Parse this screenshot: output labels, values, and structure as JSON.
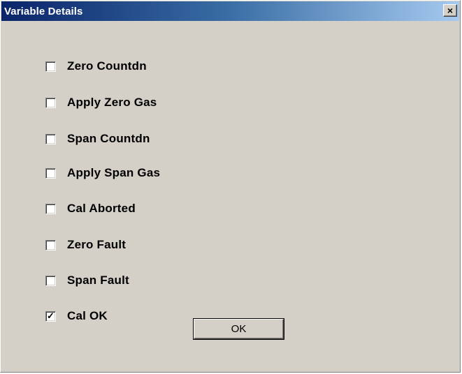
{
  "window": {
    "title": "Variable Details",
    "close_label": "×"
  },
  "checkboxes": [
    {
      "label": "Zero Countdn",
      "checked": false
    },
    {
      "label": "Apply Zero Gas",
      "checked": false
    },
    {
      "label": "Span Countdn",
      "checked": false
    },
    {
      "label": "Apply Span Gas",
      "checked": false
    },
    {
      "label": "Cal Aborted",
      "checked": false
    },
    {
      "label": "Zero Fault",
      "checked": false
    },
    {
      "label": "Span Fault",
      "checked": false
    },
    {
      "label": "Cal OK",
      "checked": true
    }
  ],
  "check_glyph": "✓",
  "buttons": {
    "ok_label": "OK"
  },
  "colors": {
    "face": "#d4d0c8",
    "title_start": "#0a246a",
    "title_end": "#a6caf0"
  }
}
